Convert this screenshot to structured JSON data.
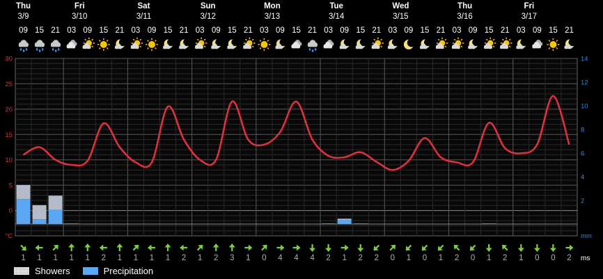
{
  "legend": {
    "showers_label": "Showers",
    "precipitation_label": "Precipitation",
    "wind_unit": "ms"
  },
  "colors": {
    "temperature": "#e0303c",
    "precipitation": "#5aa7f5",
    "showers": "#5b8fd0",
    "wind_arrow": "#7cd13a",
    "left_axis": "#e0303c",
    "right_axis": "#2e8ae6",
    "background": "#000000"
  },
  "chart_data": {
    "type": "line",
    "title": "",
    "days": [
      {
        "day": "Thu",
        "date": "3/9"
      },
      {
        "day": "Fri",
        "date": "3/10"
      },
      {
        "day": "Sat",
        "date": "3/11"
      },
      {
        "day": "Sun",
        "date": "3/12"
      },
      {
        "day": "Mon",
        "date": "3/13"
      },
      {
        "day": "Tue",
        "date": "3/14"
      },
      {
        "day": "Wed",
        "date": "3/15"
      },
      {
        "day": "Thu",
        "date": "3/16"
      },
      {
        "day": "Fri",
        "date": "3/17"
      }
    ],
    "hours": [
      "09",
      "15",
      "21",
      "03",
      "09",
      "15",
      "21",
      "03",
      "09",
      "15",
      "21",
      "03",
      "09",
      "15",
      "21",
      "03",
      "09",
      "15",
      "21",
      "03",
      "09",
      "15",
      "21",
      "03",
      "09",
      "15",
      "21",
      "03",
      "09",
      "15",
      "21",
      "03",
      "09",
      "15",
      "21"
    ],
    "weather_icons": [
      "rain",
      "rain",
      "rain",
      "cloudy",
      "partly-cloudy-day",
      "sunny",
      "partly-cloudy-night",
      "partly-cloudy-day",
      "sunny",
      "partly-cloudy-night",
      "partly-cloudy-night",
      "partly-cloudy-day",
      "partly-cloudy-night",
      "partly-cloudy-night",
      "partly-cloudy-day",
      "sunny",
      "partly-cloudy-night",
      "cloudy",
      "rain",
      "cloudy",
      "partly-cloudy-night",
      "partly-cloudy-night",
      "partly-cloudy-day",
      "partly-cloudy-night",
      "clear-night",
      "partly-cloudy-night",
      "partly-cloudy-day",
      "partly-cloudy-day",
      "partly-cloudy-night",
      "partly-cloudy-day",
      "partly-cloudy-day",
      "partly-cloudy-night",
      "cloudy",
      "sunny",
      "partly-cloudy-night"
    ],
    "temperature": {
      "unit": "°C",
      "ylim": [
        -5,
        30
      ],
      "ticks": [
        30,
        25,
        20,
        15,
        10,
        5,
        0
      ],
      "values": [
        11,
        12.5,
        10,
        9,
        9.8,
        17.2,
        12.5,
        9.5,
        9.5,
        20.5,
        14,
        10,
        10,
        21.5,
        14,
        13,
        15.5,
        21.5,
        14,
        10.8,
        10.5,
        11.5,
        9.6,
        8,
        9.8,
        14.3,
        10.5,
        9.5,
        9.5,
        17.3,
        12.3,
        11.3,
        13,
        22.6,
        13
      ]
    },
    "precipitation": {
      "unit": "mm",
      "ylim": [
        -1,
        14
      ],
      "ticks": [
        14,
        12,
        10,
        8,
        6,
        4,
        2
      ],
      "values": [
        2.1,
        0.4,
        1.2,
        0.05,
        0,
        0,
        0,
        0,
        0,
        0,
        0,
        0,
        0,
        0,
        0,
        0,
        0,
        0,
        0,
        0.05,
        0.35,
        0.05,
        0,
        0,
        0,
        0,
        0,
        0,
        0,
        0.05,
        0,
        0,
        0,
        0,
        0
      ],
      "showers": [
        1.2,
        1.2,
        1.2,
        0,
        0,
        0,
        0,
        0,
        0,
        0,
        0,
        0,
        0,
        0,
        0,
        0,
        0,
        0,
        0,
        0,
        0.1,
        0,
        0,
        0,
        0,
        0,
        0,
        0,
        0,
        0,
        0,
        0,
        0,
        0,
        0
      ]
    },
    "wind": {
      "unit": "ms",
      "directions": [
        "se",
        "w",
        "ne",
        "n",
        "n",
        "w",
        "n",
        "ne",
        "w",
        "n",
        "w",
        "ne",
        "n",
        "n",
        "e",
        "ne",
        "e",
        "e",
        "s",
        "s",
        "e",
        "s",
        "sw",
        "ne",
        "sw",
        "sw",
        "sw",
        "nw",
        "sw",
        "s",
        "nw",
        "s",
        "s",
        "s",
        "e"
      ],
      "speeds": [
        "1",
        "1",
        "1",
        "1",
        "1",
        "2",
        "1",
        "1",
        "1",
        "1",
        "2",
        "1",
        "2",
        "3",
        "1",
        "0",
        "4",
        "4",
        "4",
        "2",
        "1",
        "2",
        "2",
        "0",
        "1",
        "0",
        "1",
        "2",
        "0",
        "1",
        "2",
        "1",
        "0",
        "0",
        "2"
      ]
    }
  }
}
